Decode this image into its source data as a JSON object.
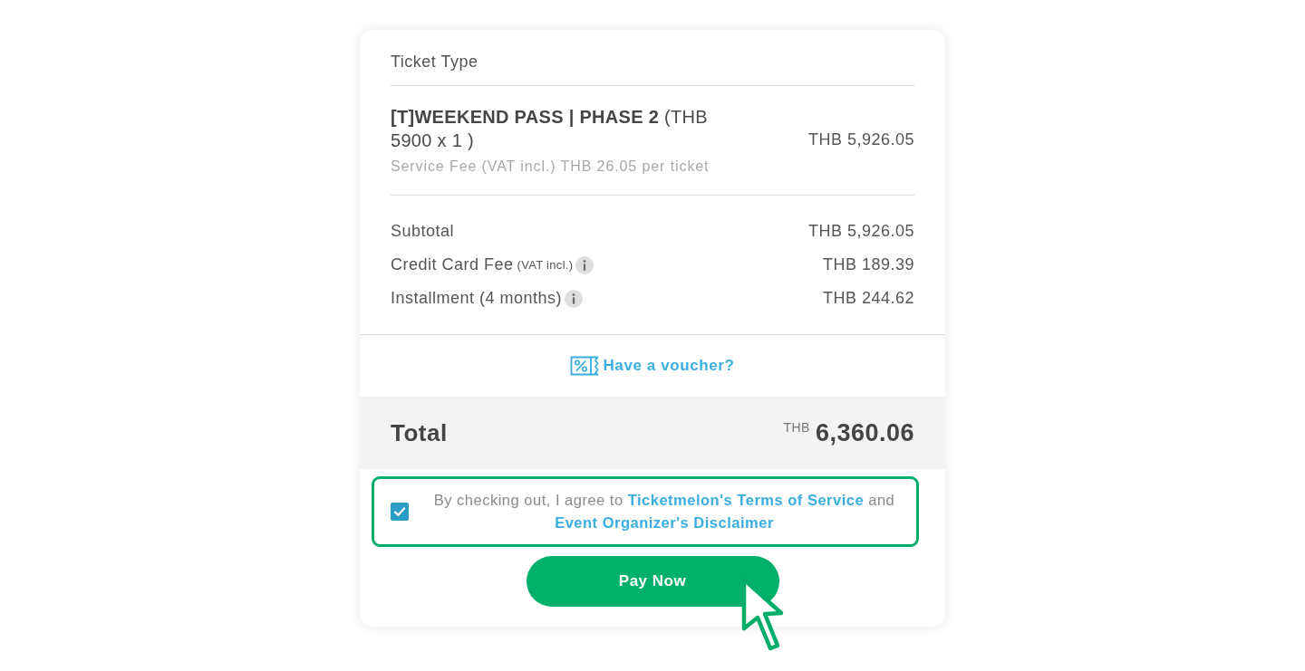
{
  "summary": {
    "heading": "Ticket Type",
    "ticket": {
      "name": "[T]WEEKEND PASS | PHASE 2",
      "detail": "(THB 5900 x 1 )",
      "price": "THB 5,926.05",
      "fee_note": "Service Fee (VAT incl.) THB 26.05 per ticket"
    },
    "lines": [
      {
        "label": "Subtotal",
        "amount": "THB 5,926.05",
        "info": false
      },
      {
        "label": "Credit Card Fee",
        "note": "(VAT incl.)",
        "info": true,
        "amount": "THB 189.39"
      },
      {
        "label": "Installment (4 months)",
        "info": true,
        "amount": "THB 244.62"
      }
    ]
  },
  "voucher": {
    "label": "Have a voucher?"
  },
  "total": {
    "label": "Total",
    "currency": "THB",
    "amount": "6,360.06"
  },
  "agreement": {
    "checked": true,
    "highlighted": true,
    "text_before": "By checking out, I agree to",
    "link_terms": "Ticketmelon's Terms of Service",
    "text_middle": "and",
    "link_disclaimer": "Event Organizer's Disclaimer"
  },
  "pay_button": {
    "label": "Pay Now"
  }
}
